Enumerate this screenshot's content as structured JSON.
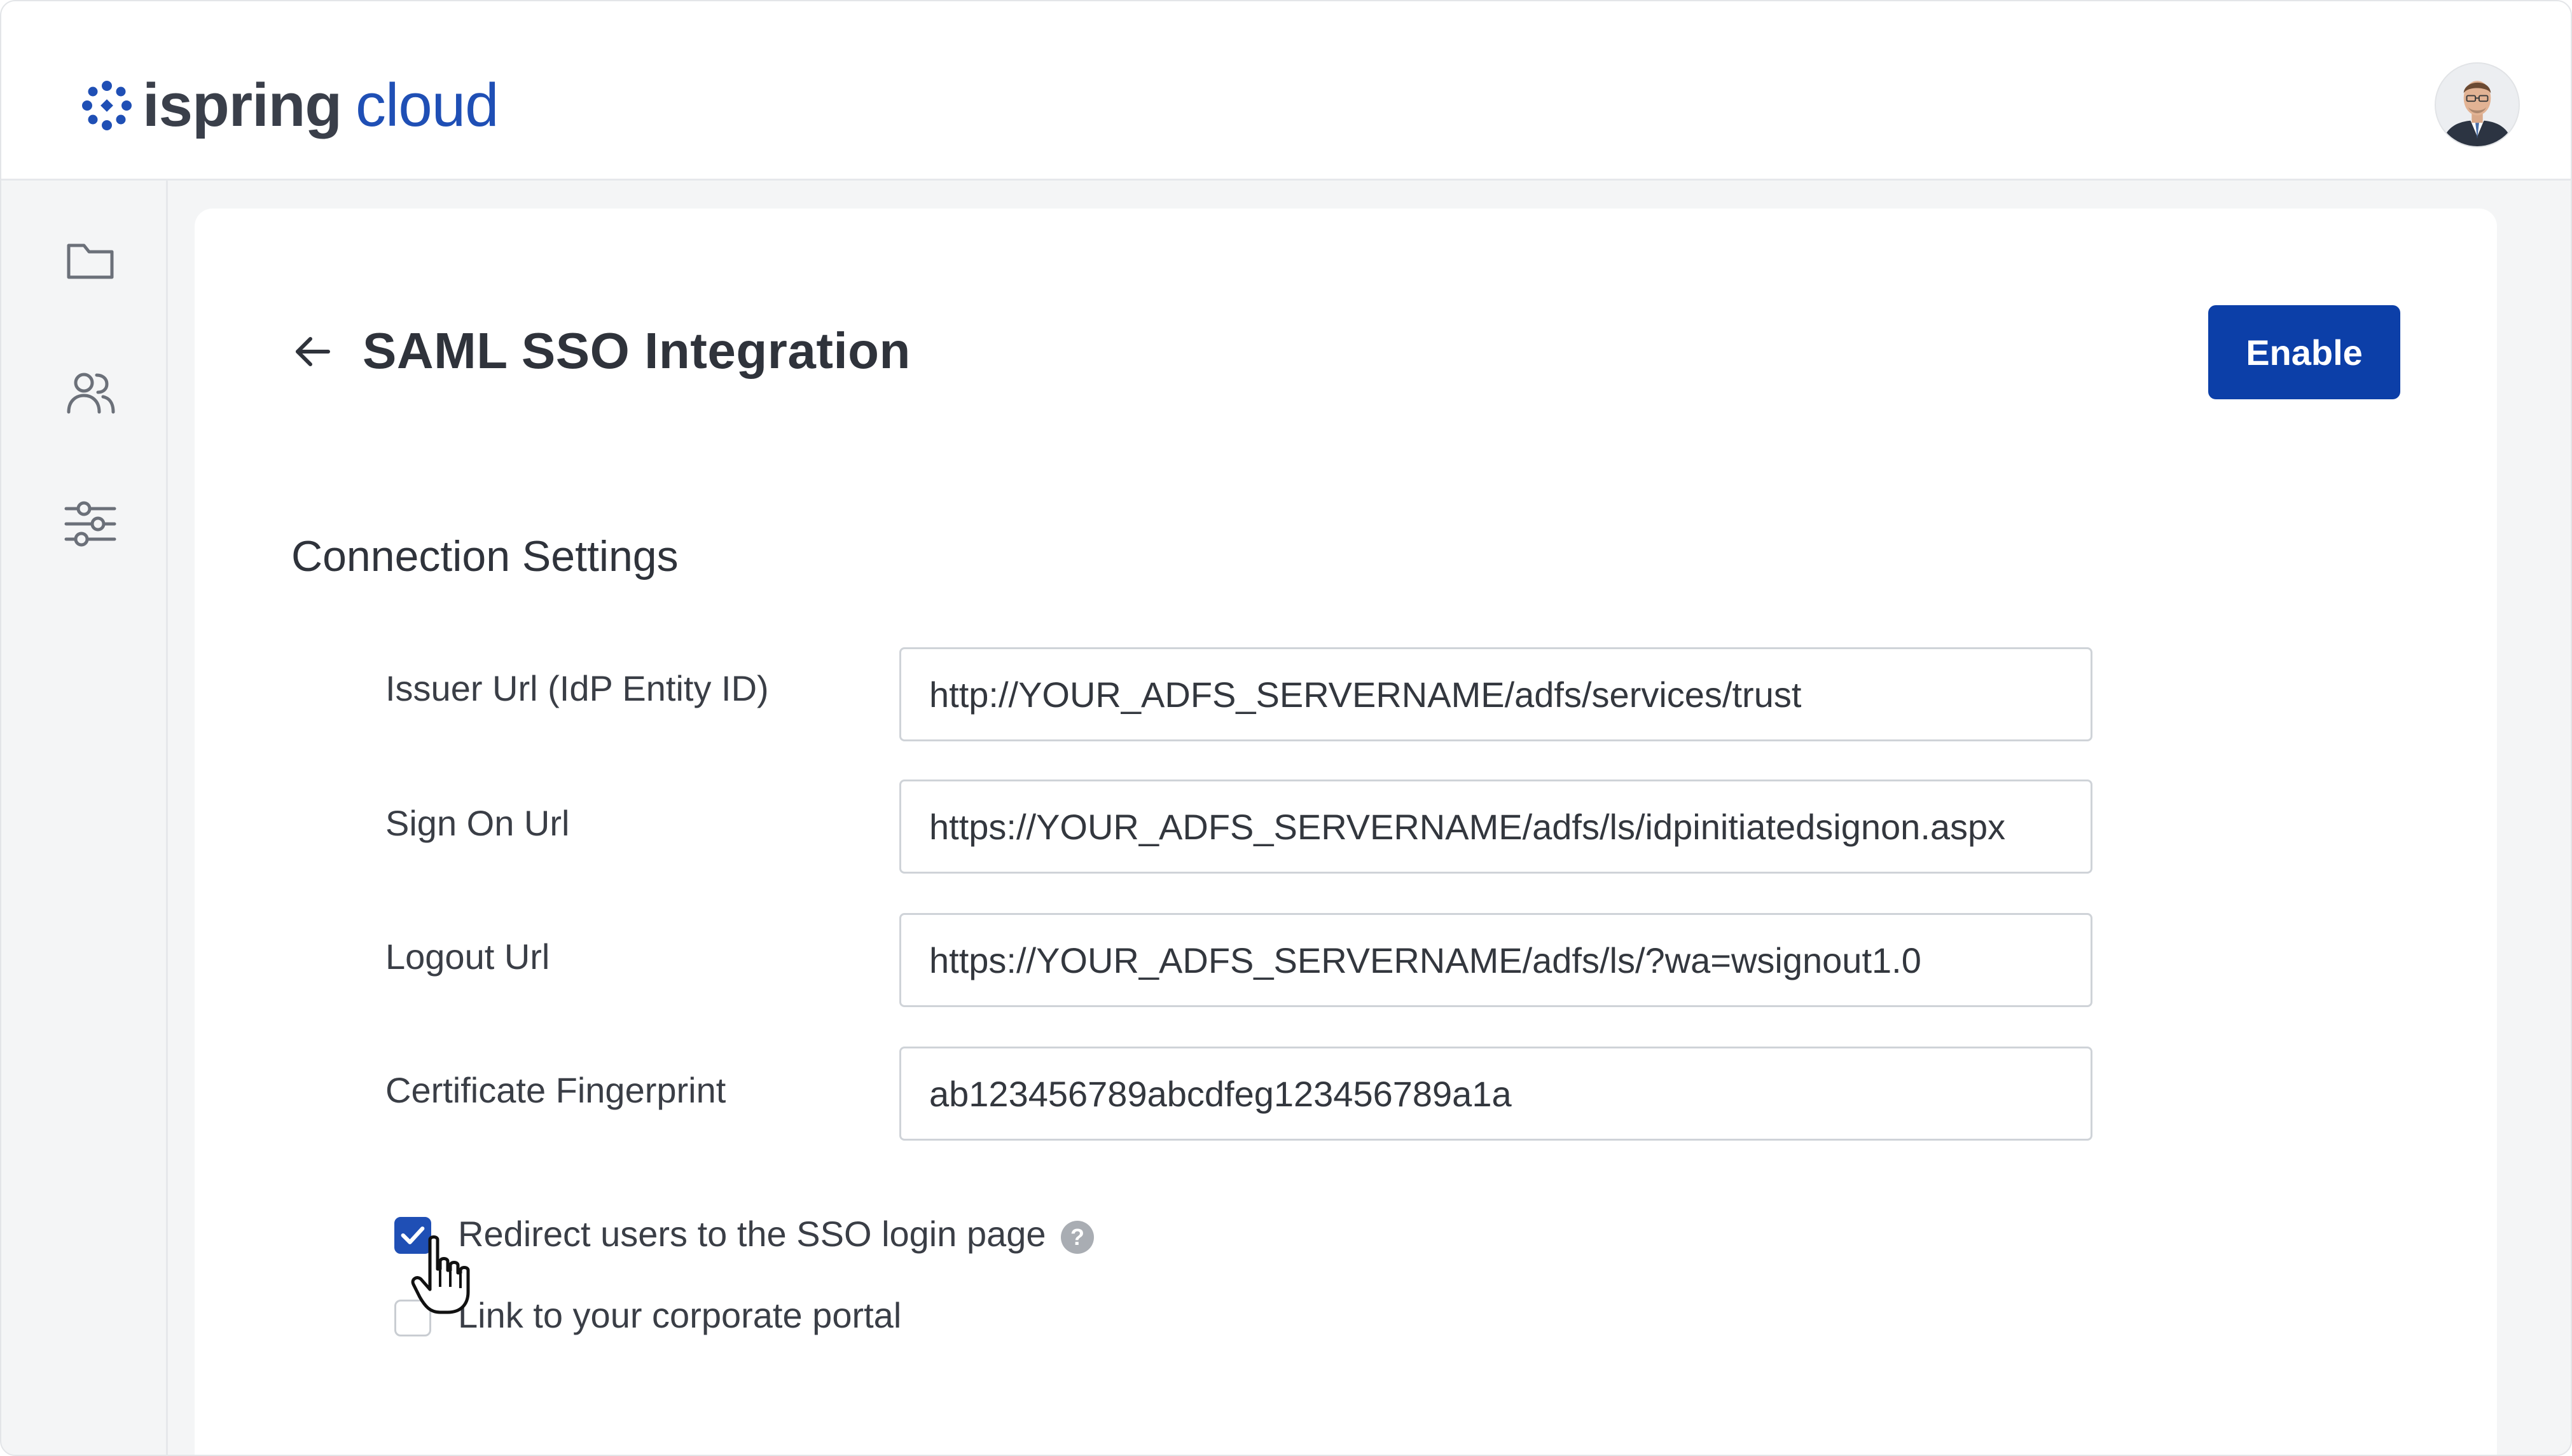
{
  "header": {
    "logo_word1": "ispring",
    "logo_word2": "cloud",
    "brand_color": "#1f4fb5",
    "avatar_icon": "user-avatar"
  },
  "sidebar": {
    "items": [
      {
        "icon": "folder-icon"
      },
      {
        "icon": "users-icon"
      },
      {
        "icon": "settings-sliders-icon"
      }
    ]
  },
  "page": {
    "title": "SAML SSO Integration",
    "back_icon": "arrow-left-icon",
    "enable_label": "Enable",
    "enable_color": "#0c3fa8"
  },
  "connection": {
    "section_title": "Connection Settings",
    "fields": [
      {
        "label": "Issuer Url (IdP Entity ID)",
        "value": "http://YOUR_ADFS_SERVERNAME/adfs/services/trust"
      },
      {
        "label": "Sign On Url",
        "value": "https://YOUR_ADFS_SERVERNAME/adfs/ls/idpinitiatedsignon.aspx"
      },
      {
        "label": "Logout Url",
        "value": "https://YOUR_ADFS_SERVERNAME/adfs/ls/?wa=wsignout1.0"
      },
      {
        "label": "Certificate Fingerprint",
        "value": "ab123456789abcdfeg123456789a1a"
      }
    ],
    "options": [
      {
        "label": "Redirect users to the SSO login page",
        "checked": true
      },
      {
        "label": "Link to your corporate portal",
        "checked": false
      }
    ],
    "help_glyph": "?"
  }
}
